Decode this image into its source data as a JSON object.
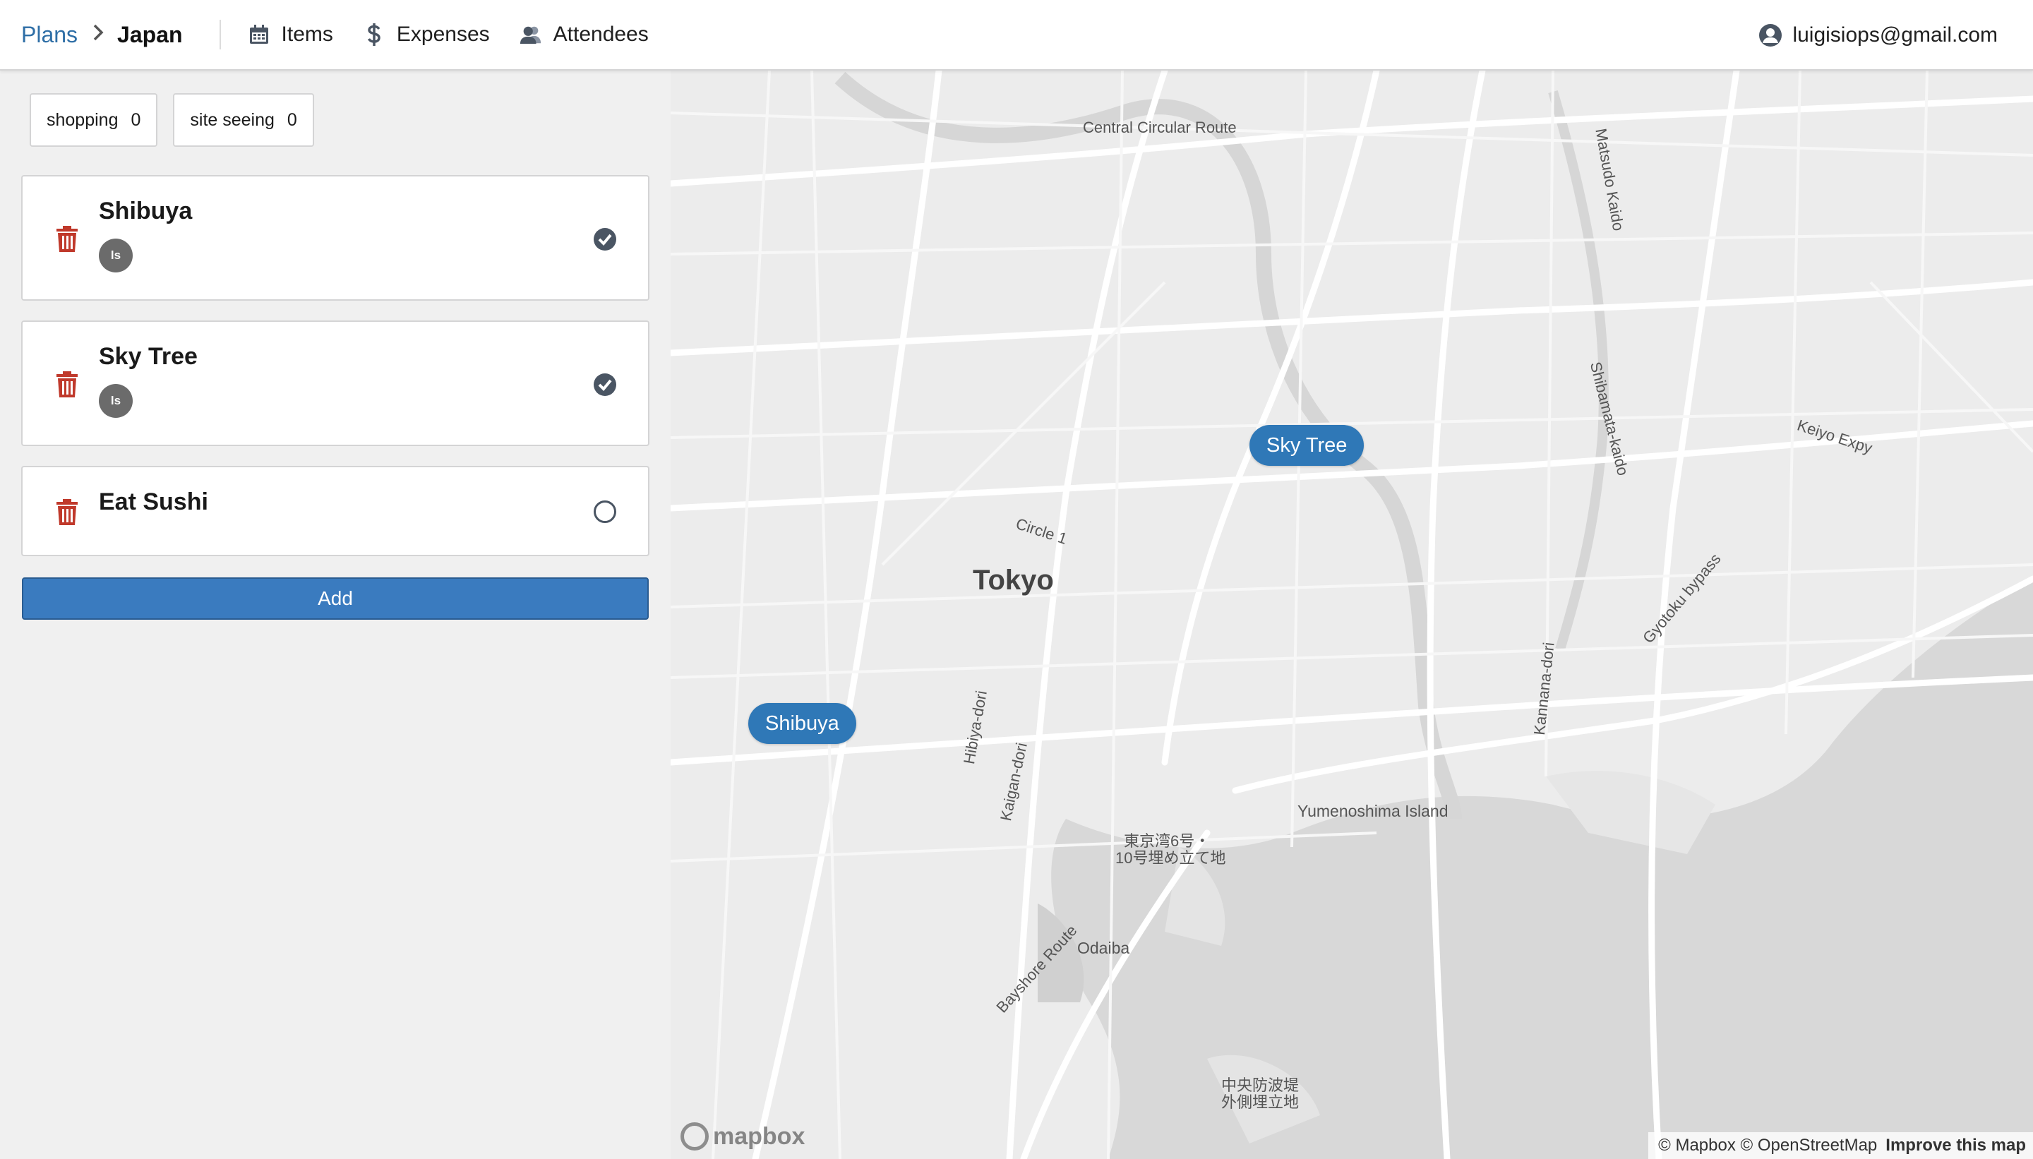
{
  "header": {
    "breadcrumb_root": "Plans",
    "breadcrumb_current": "Japan",
    "nav": [
      {
        "label": "Items",
        "icon": "calendar-icon"
      },
      {
        "label": "Expenses",
        "icon": "dollar-icon"
      },
      {
        "label": "Attendees",
        "icon": "users-icon"
      }
    ],
    "user_email": "luigisiops@gmail.com"
  },
  "categories": [
    {
      "label": "shopping",
      "count": "0"
    },
    {
      "label": "site seeing",
      "count": "0"
    }
  ],
  "items": [
    {
      "title": "Shibuya",
      "avatar": "ls",
      "done": true
    },
    {
      "title": "Sky Tree",
      "avatar": "ls",
      "done": true
    },
    {
      "title": "Eat Sushi",
      "avatar": "",
      "done": false
    }
  ],
  "add_label": "Add",
  "map": {
    "markers": [
      "Sky Tree",
      "Shibuya"
    ],
    "city": "Tokyo",
    "labels": [
      "Central Circular Route",
      "Circle 1",
      "Yumenoshima Island",
      "Odaiba",
      "Bayshore Route",
      "Keiyo Expy",
      "東京湾6号・",
      "10号埋め立て地",
      "中央防波堤",
      "外側埋立地",
      "Matsudo Kaido",
      "Shibamata-kaido",
      "Gyotoku bypass",
      "Kannana-dori",
      "Hibiya-dori",
      "Kaigan-dori"
    ],
    "attribution": "© Mapbox © OpenStreetMap",
    "improve": "Improve this map",
    "logo": "mapbox"
  },
  "colors": {
    "accent": "#3a7bbf",
    "marker": "#2f78b7",
    "trash": "#c0392b",
    "link": "#2e6ea6"
  }
}
